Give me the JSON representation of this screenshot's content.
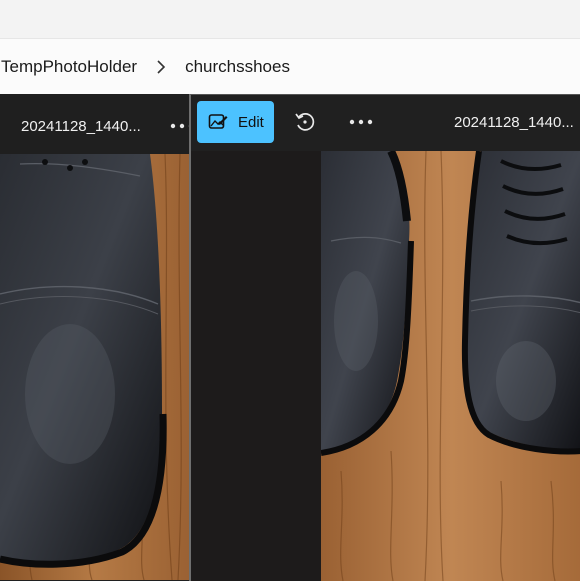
{
  "explorer": {
    "breadcrumb": [
      "TempPhotoHolder",
      "churchsshoes"
    ]
  },
  "photo_back": {
    "filename": "20241128_1440..."
  },
  "photo_front": {
    "edit_label": "Edit",
    "filename": "20241128_1440..."
  },
  "colors": {
    "accent": "#4cc2ff",
    "dark_bg": "#202020",
    "wood": "#a36a3a",
    "shoe": "#1a1c20"
  }
}
